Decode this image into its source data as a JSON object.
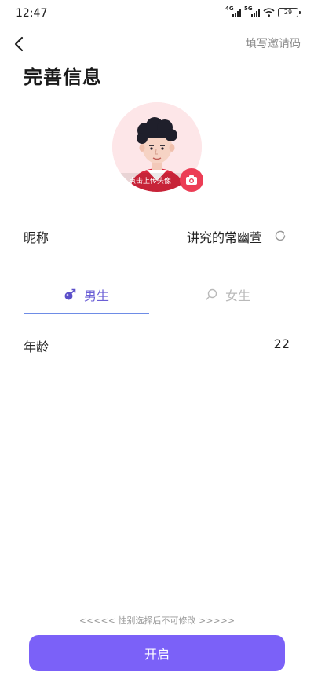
{
  "status_bar": {
    "time": "12:47",
    "network_1": "4G",
    "network_2": "5G",
    "battery": "29"
  },
  "header": {
    "back_icon": "chevron-left-icon",
    "invite_link": "填写邀请码",
    "title": "完善信息"
  },
  "avatar": {
    "upload_hint": "点击上传头像",
    "camera_icon": "camera-icon"
  },
  "nickname": {
    "label": "昵称",
    "value": "讲究的常幽萱",
    "refresh_icon": "refresh-icon"
  },
  "gender": {
    "tabs": [
      {
        "label": "男生",
        "icon": "male-icon",
        "selected": true
      },
      {
        "label": "女生",
        "icon": "female-icon",
        "selected": false
      }
    ]
  },
  "age": {
    "label": "年龄",
    "value": "22"
  },
  "footer": {
    "note": "<<<<< 性别选择后不可修改 >>>>>",
    "start_button": "开启"
  },
  "colors": {
    "accent": "#7b61f8",
    "tab_active_text": "#6b5fd6",
    "tab_underline": "#6e8ce6",
    "camera_badge": "#ec3d55"
  }
}
